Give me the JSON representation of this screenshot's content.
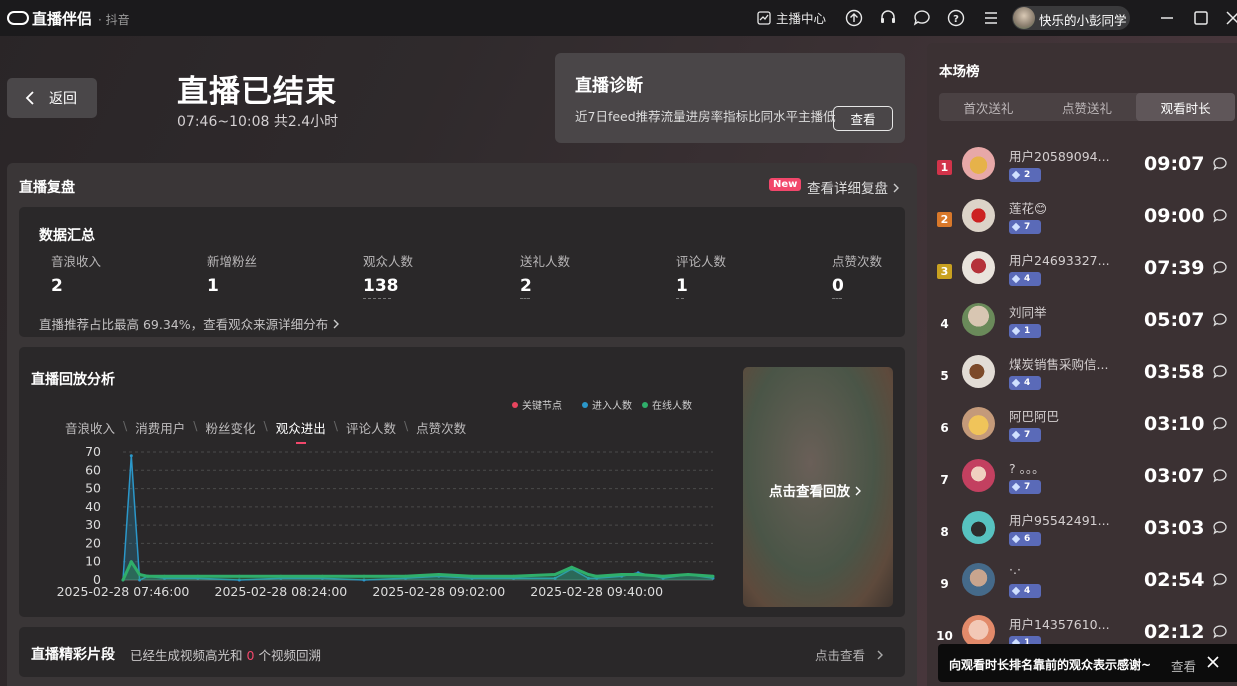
{
  "app": {
    "name": "直播伴侣",
    "platform": "· 抖音"
  },
  "titlebar": {
    "anchor_center": "主播中心",
    "username": "快乐的小彭同学"
  },
  "back_label": "返回",
  "ended": {
    "title": "直播已结束",
    "time": "07:46~10:08 共2.4小时"
  },
  "diagnosis": {
    "title": "直播诊断",
    "text": "近7日feed推荐流量进房率指标比同水平主播低",
    "button": "查看"
  },
  "review": {
    "title": "直播复盘",
    "new_badge": "New",
    "detail_link": "查看详细复盘"
  },
  "summary": {
    "title": "数据汇总",
    "metrics": [
      {
        "label": "音浪收入",
        "value": "2"
      },
      {
        "label": "新增粉丝",
        "value": "1"
      },
      {
        "label": "观众人数",
        "value": "138"
      },
      {
        "label": "送礼人数",
        "value": "2"
      },
      {
        "label": "评论人数",
        "value": "1"
      },
      {
        "label": "点赞次数",
        "value": "0"
      }
    ],
    "footer": "直播推荐占比最高 69.34%，查看观众来源详细分布"
  },
  "replay": {
    "title": "直播回放分析",
    "legend": [
      "关键节点",
      "进入人数",
      "在线人数"
    ],
    "legend_colors": [
      "#e8455e",
      "#2b97c9",
      "#2fae6a"
    ],
    "tabs": [
      "音浪收入",
      "消费用户",
      "粉丝变化",
      "观众进出",
      "评论人数",
      "点赞次数"
    ],
    "active_tab": "观众进出",
    "thumb_label": "点击查看回放"
  },
  "chart_data": {
    "type": "area",
    "ylim": [
      0,
      70
    ],
    "yticks": [
      70,
      60,
      50,
      40,
      30,
      20,
      10,
      0
    ],
    "xtick_labels": [
      "2025-02-28 07:46:00",
      "2025-02-28 08:24:00",
      "2025-02-28 09:02:00",
      "2025-02-28 09:40:00"
    ],
    "x": [
      "07:46",
      "07:48",
      "07:50",
      "07:52",
      "07:56",
      "08:04",
      "08:14",
      "08:24",
      "08:34",
      "08:44",
      "08:54",
      "09:02",
      "09:10",
      "09:20",
      "09:30",
      "09:34",
      "09:38",
      "09:40",
      "09:46",
      "09:50",
      "09:56",
      "10:02",
      "10:08"
    ],
    "series": [
      {
        "name": "进入人数",
        "values": [
          0,
          68,
          0,
          2,
          1,
          1,
          0,
          1,
          1,
          0,
          1,
          2,
          1,
          1,
          1,
          6,
          1,
          1,
          2,
          4,
          1,
          3,
          1
        ]
      },
      {
        "name": "在线人数",
        "values": [
          0,
          10,
          3,
          2,
          2,
          2,
          2,
          2,
          2,
          2,
          2,
          3,
          2,
          2,
          3,
          7,
          3,
          2,
          3,
          3,
          2,
          3,
          2
        ]
      }
    ]
  },
  "highlights": {
    "title": "直播精彩片段",
    "text_pre": "已经生成视频高光和",
    "count": "0",
    "text_post": "个视频回溯",
    "link": "点击查看"
  },
  "leaderboard": {
    "title": "本场榜",
    "tabs": [
      "首次送礼",
      "点赞送礼",
      "观看时长"
    ],
    "active_tab": "观看时长",
    "rows": [
      {
        "rank": "1",
        "name": "用户20589094...",
        "level": "2",
        "duration": "09:07"
      },
      {
        "rank": "2",
        "name": "莲花😊",
        "level": "7",
        "duration": "09:00"
      },
      {
        "rank": "3",
        "name": "用户24693327...",
        "level": "4",
        "duration": "07:39"
      },
      {
        "rank": "4",
        "name": "刘同举",
        "level": "1",
        "duration": "05:07"
      },
      {
        "rank": "5",
        "name": "煤炭销售采购信...",
        "level": "4",
        "duration": "03:58"
      },
      {
        "rank": "6",
        "name": "阿巴阿巴",
        "level": "7",
        "duration": "03:10"
      },
      {
        "rank": "7",
        "name": "? 。。。",
        "level": "7",
        "duration": "03:07"
      },
      {
        "rank": "8",
        "name": "用户95542491...",
        "level": "6",
        "duration": "03:03"
      },
      {
        "rank": "9",
        "name": "·.·",
        "level": "4",
        "duration": "02:54"
      },
      {
        "rank": "10",
        "name": "用户14357610...",
        "level": "1",
        "duration": "02:12"
      }
    ],
    "rank_colors": [
      "#d2334a",
      "#d9782a",
      "#c9a120"
    ]
  },
  "toast": {
    "text": "向观看时长排名靠前的观众表示感谢~",
    "view": "查看"
  }
}
